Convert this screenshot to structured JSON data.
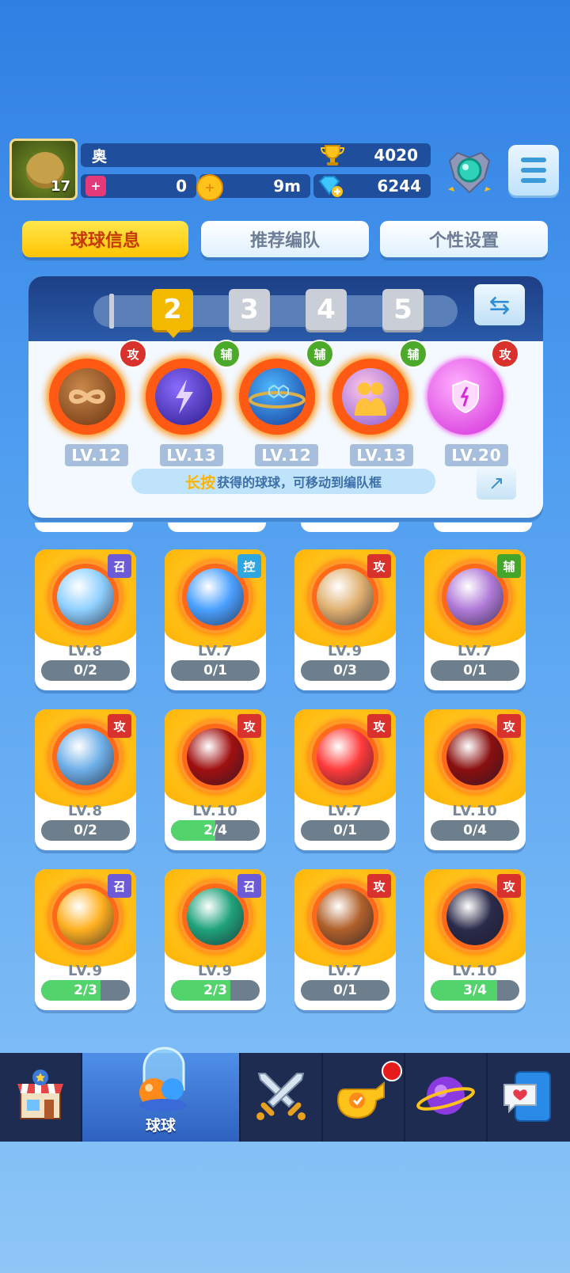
{
  "player": {
    "name": "奥",
    "level": "17",
    "trophies": "4020",
    "stat_zero": "0",
    "timer": "9m",
    "gems": "6244"
  },
  "tabs": [
    {
      "label": "球球信息",
      "active": true
    },
    {
      "label": "推荐编队",
      "active": false
    },
    {
      "label": "个性设置",
      "active": false
    }
  ],
  "team": {
    "slots": [
      "2",
      "3",
      "4",
      "5"
    ],
    "selected": "2",
    "balls": [
      {
        "level": "LV.12",
        "role": "攻",
        "icon": "infinity-ball"
      },
      {
        "level": "LV.13",
        "role": "辅",
        "icon": "lightning-ball"
      },
      {
        "level": "LV.12",
        "role": "辅",
        "icon": "hex-planet-ball"
      },
      {
        "level": "LV.13",
        "role": "辅",
        "icon": "crowd-ball"
      },
      {
        "level": "LV.20",
        "role": "攻",
        "icon": "broken-shield-ball"
      }
    ],
    "hint_highlight": "长按",
    "hint_text": "获得的球球，可移动到编队框"
  },
  "cards": [
    {
      "role": "召",
      "level": "LV.8",
      "progress": "0/2",
      "fill": 0,
      "icon": "ice-bloom-ball",
      "color": "#8fd0ff"
    },
    {
      "role": "控",
      "level": "LV.7",
      "progress": "0/1",
      "fill": 0,
      "icon": "magician-hat-ball",
      "color": "#4aa0ff"
    },
    {
      "role": "攻",
      "level": "LV.9",
      "progress": "0/3",
      "fill": 0,
      "icon": "old-man-ball",
      "color": "#e0b070"
    },
    {
      "role": "辅",
      "level": "LV.7",
      "progress": "0/1",
      "fill": 0,
      "icon": "mage-girl-ball",
      "color": "#b07ad8"
    },
    {
      "role": "攻",
      "level": "LV.8",
      "progress": "0/2",
      "fill": 0,
      "icon": "sword-ball",
      "color": "#6fb0e8"
    },
    {
      "role": "攻",
      "level": "LV.10",
      "progress": "2/4",
      "fill": 0.5,
      "icon": "venom-ball",
      "color": "#a01010"
    },
    {
      "role": "攻",
      "level": "LV.7",
      "progress": "0/1",
      "fill": 0,
      "icon": "red-blob-ball",
      "color": "#ff3a3a"
    },
    {
      "role": "攻",
      "level": "LV.10",
      "progress": "0/4",
      "fill": 0,
      "icon": "trident-ball",
      "color": "#8a0f0f"
    },
    {
      "role": "召",
      "level": "LV.9",
      "progress": "2/3",
      "fill": 0.667,
      "icon": "golden-hand-ball",
      "color": "#ffb020"
    },
    {
      "role": "召",
      "level": "LV.9",
      "progress": "2/3",
      "fill": 0.667,
      "icon": "swirl-seed-ball",
      "color": "#1fa37a"
    },
    {
      "role": "攻",
      "level": "LV.7",
      "progress": "0/1",
      "fill": 0,
      "icon": "bear-ball",
      "color": "#b0602a"
    },
    {
      "role": "攻",
      "level": "LV.10",
      "progress": "3/4",
      "fill": 0.75,
      "icon": "opera-mask-ball",
      "color": "#2a2a4a"
    }
  ],
  "nav": [
    {
      "label": "",
      "icon": "shop-icon"
    },
    {
      "label": "球球",
      "icon": "balls-icon",
      "active": true
    },
    {
      "label": "",
      "icon": "crossed-swords-icon"
    },
    {
      "label": "",
      "icon": "whistle-icon",
      "badge": true
    },
    {
      "label": "",
      "icon": "planet-icon"
    },
    {
      "label": "",
      "icon": "chat-heart-icon"
    }
  ],
  "role_colors": {
    "攻": "#d9322c",
    "辅": "#43a52a",
    "召": "#6c5ad6",
    "控": "#2fa6e0"
  }
}
